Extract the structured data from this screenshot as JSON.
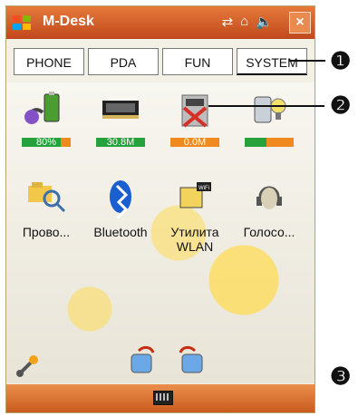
{
  "app": {
    "title": "M-Desk"
  },
  "tabs": [
    "PHONE",
    "PDA",
    "FUN",
    "SYSTEM"
  ],
  "row1": [
    {
      "name": "battery",
      "meter_text": "80%",
      "meter": {
        "used": 0.8,
        "free": 0.2
      }
    },
    {
      "name": "memory",
      "meter_text": "30.8M",
      "meter": {
        "used": 1.0,
        "free": 0.0
      }
    },
    {
      "name": "storage-card",
      "meter_text": "0.0M",
      "meter": {
        "used": 0.0,
        "free": 1.0
      }
    },
    {
      "name": "system-info",
      "meter_text": "",
      "meter": {
        "used": 0.45,
        "free": 0.55
      }
    }
  ],
  "row2": [
    {
      "name": "explorer",
      "label": "Прово..."
    },
    {
      "name": "bluetooth",
      "label": "Bluetooth"
    },
    {
      "name": "wlan-utility",
      "label": "Утилита WLAN"
    },
    {
      "name": "voice",
      "label": "Голосо..."
    }
  ],
  "callouts": [
    "❶",
    "❷",
    "❸"
  ]
}
